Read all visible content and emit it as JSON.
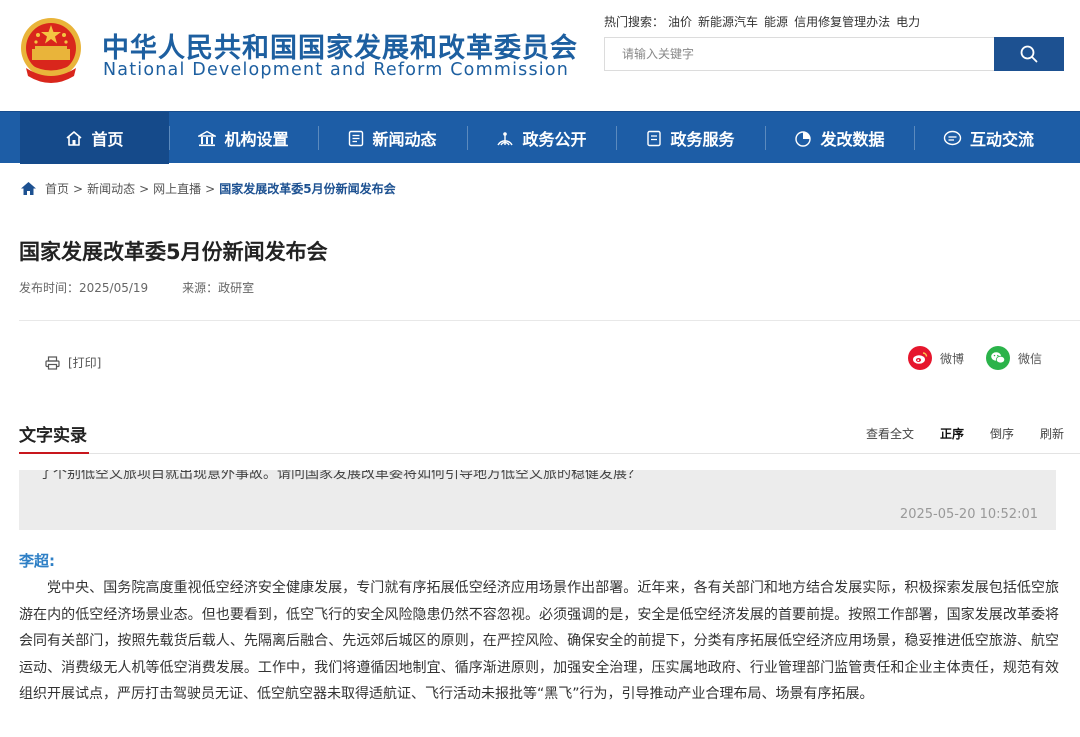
{
  "site": {
    "title_cn": "中华人民共和国国家发展和改革委员会",
    "title_en": "National Development and Reform Commission"
  },
  "hot_search": {
    "label": "热门搜索：",
    "items": [
      "油价",
      "新能源汽车",
      "能源",
      "信用修复管理办法",
      "电力"
    ]
  },
  "search": {
    "placeholder": "请输入关键字"
  },
  "nav": [
    {
      "label": "首页",
      "icon": "home-icon"
    },
    {
      "label": "机构设置",
      "icon": "building-icon"
    },
    {
      "label": "新闻动态",
      "icon": "news-icon"
    },
    {
      "label": "政务公开",
      "icon": "broadcast-icon"
    },
    {
      "label": "政务服务",
      "icon": "document-icon"
    },
    {
      "label": "发改数据",
      "icon": "pie-chart-icon"
    },
    {
      "label": "互动交流",
      "icon": "chat-icon"
    }
  ],
  "breadcrumb": {
    "items": [
      "首页",
      "新闻动态",
      "网上直播"
    ],
    "current": "国家发展改革委5月份新闻发布会"
  },
  "article": {
    "title": "国家发展改革委5月份新闻发布会",
    "published": "发布时间：2025/05/19",
    "source": "来源：政研室"
  },
  "tools": {
    "print": "[打印]",
    "weibo": "微博",
    "wechat": "微信"
  },
  "transcript": {
    "title": "文字实录",
    "controls": [
      "查看全文",
      "正序",
      "倒序",
      "刷新"
    ],
    "active_control": "正序",
    "question_text": "了个别低空文旅项目就出现意外事故。请问国家发展改革委将如何引导地方低空文旅的稳健发展？",
    "question_time": "2025-05-20 10:52:01",
    "speaker": "李超:",
    "answer": "党中央、国务院高度重视低空经济安全健康发展，专门就有序拓展低空经济应用场景作出部署。近年来，各有关部门和地方结合发展实际，积极探索发展包括低空旅游在内的低空经济场景业态。但也要看到，低空飞行的安全风险隐患仍然不容忽视。必须强调的是，安全是低空经济发展的首要前提。按照工作部署，国家发展改革委将会同有关部门，按照先载货后载人、先隔离后融合、先远郊后城区的原则，在严控风险、确保安全的前提下，分类有序拓展低空经济应用场景，稳妥推进低空旅游、航空运动、消费级无人机等低空消费发展。工作中，我们将遵循因地制宜、循序渐进原则，加强安全治理，压实属地政府、行业管理部门监管责任和企业主体责任，规范有效组织开展试点，严厉打击驾驶员无证、低空航空器未取得适航证、飞行活动未报批等“黑飞”行为，引导推动产业合理布局、场景有序拓展。"
  },
  "colors": {
    "brand_blue": "#1d5fa0",
    "nav_bg": "#1d5da6",
    "accent_red": "#c8161d",
    "speaker_blue": "#2f80c6"
  }
}
